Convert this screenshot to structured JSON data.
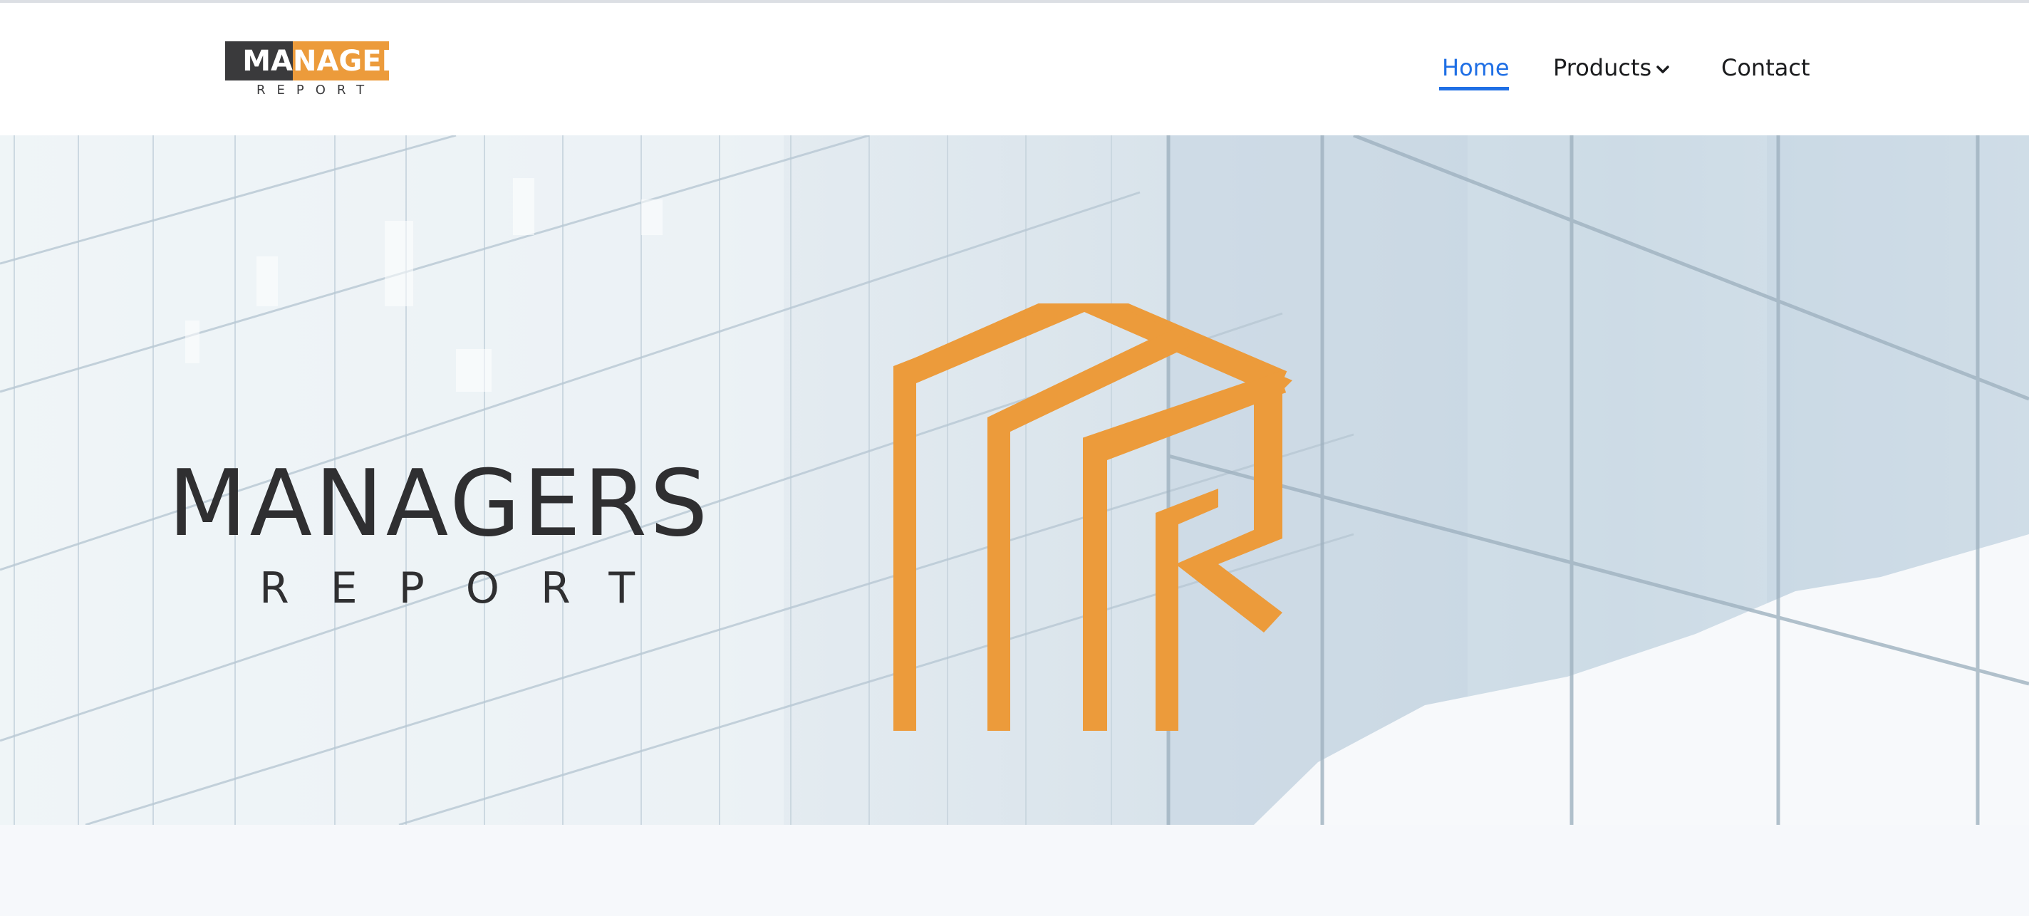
{
  "header": {
    "logo": {
      "part1": "MA",
      "part2": "NAGERS",
      "sub": "REPORT",
      "colors": {
        "dark": "#3a3a3c",
        "orange": "#ec9b3b"
      }
    },
    "nav": {
      "home": "Home",
      "products": "Products",
      "contact": "Contact",
      "active_color": "#1f6fe5"
    }
  },
  "hero": {
    "title": "MANAGERS",
    "subtitle": "REPORT",
    "mark_color": "#ec9b3b",
    "icon": "managers-report-mark-icon"
  }
}
